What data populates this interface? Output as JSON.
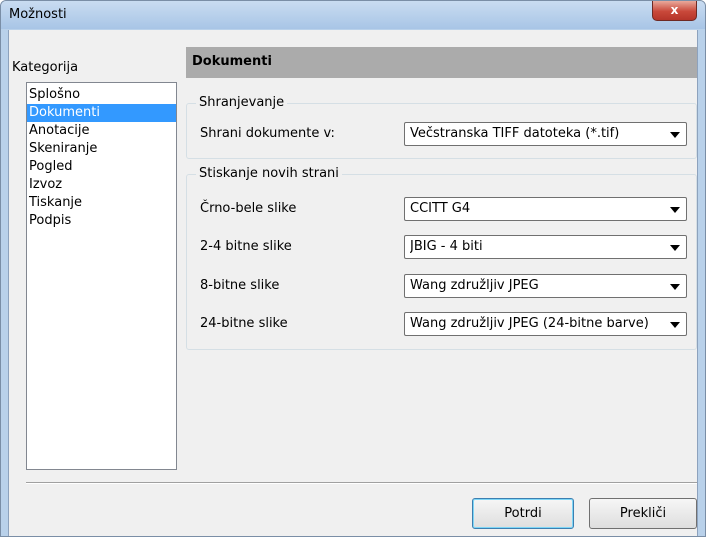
{
  "window": {
    "title": "Možnosti",
    "close_glyph": "x"
  },
  "sidebar": {
    "label": "Kategorija",
    "items": [
      {
        "label": "Splošno"
      },
      {
        "label": "Dokumenti",
        "selected": true
      },
      {
        "label": "Anotacije"
      },
      {
        "label": "Skeniranje"
      },
      {
        "label": "Pogled"
      },
      {
        "label": "Izvoz"
      },
      {
        "label": "Tiskanje"
      },
      {
        "label": "Podpis"
      }
    ]
  },
  "main": {
    "header": "Dokumenti",
    "save_group": {
      "title": "Shranjevanje",
      "label": "Shrani dokumente v:",
      "value": "Večstranska TIFF datoteka (*.tif)"
    },
    "compression_group": {
      "title": "Stiskanje novih strani",
      "rows": [
        {
          "label": "Črno-bele slike",
          "value": "CCITT G4"
        },
        {
          "label": "2-4 bitne slike",
          "value": "JBIG - 4 biti"
        },
        {
          "label": "8-bitne slike",
          "value": "Wang združljiv JPEG"
        },
        {
          "label": "24-bitne slike",
          "value": "Wang združljiv JPEG (24-bitne barve)"
        }
      ]
    }
  },
  "footer": {
    "ok_label": "Potrdi",
    "cancel_label": "Prekliči"
  },
  "colors": {
    "selection": "#3399ff",
    "header_bar": "#ababab",
    "dialog_bg": "#f0f0f0",
    "close_button": "#c9483a"
  }
}
